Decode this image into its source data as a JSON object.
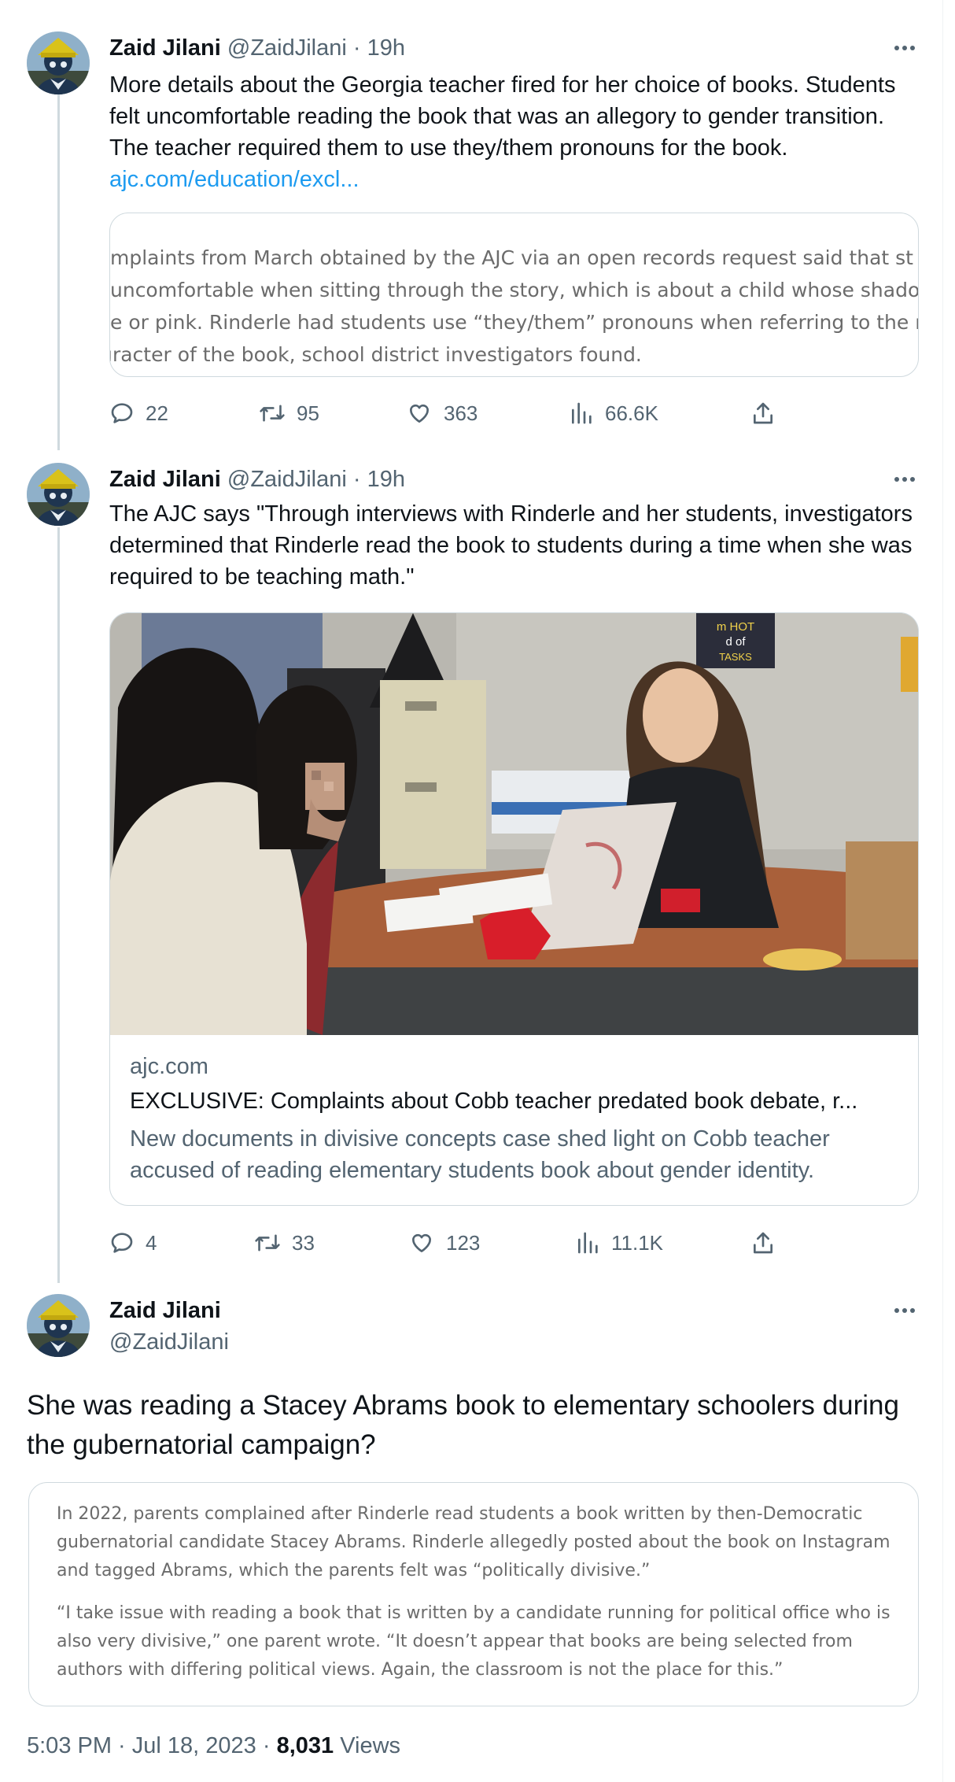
{
  "thread": [
    {
      "author": {
        "name": "Zaid Jilani",
        "handle": "@ZaidJilani",
        "time": "· 19h"
      },
      "text": "More details about the Georgia teacher fired for her choice of books. Students felt uncomfortable reading the book that was an allegory to gender transition. The teacher required them to use they/them pronouns for the book.",
      "link_text": "ajc.com/education/excl...",
      "quoted_excerpt": [
        "mplaints from March obtained by the AJC via an open records request said that st",
        " uncomfortable when sitting through the story, which is about a child whose shado",
        "e or pink. Rinderle had students use “they/them” pronouns when referring to the m",
        "ıracter of the book, school district investigators found."
      ],
      "stats": {
        "replies": "22",
        "retweets": "95",
        "likes": "363",
        "views": "66.6K"
      }
    },
    {
      "author": {
        "name": "Zaid Jilani",
        "handle": "@ZaidJilani",
        "time": "· 19h"
      },
      "text": "The AJC says \"Through interviews with Rinderle and her students, investigators determined that Rinderle read the book to students during a time when she was required to be teaching math.\"",
      "card": {
        "poster_text": [
          "m HOT",
          "d of",
          "TASKS"
        ],
        "domain": "ajc.com",
        "title": "EXCLUSIVE: Complaints about Cobb teacher predated book debate, r...",
        "description": "New documents in divisive concepts case shed light on Cobb teacher accused of reading elementary students book about gender identity."
      },
      "stats": {
        "replies": "4",
        "retweets": "33",
        "likes": "123",
        "views": "11.1K"
      }
    }
  ],
  "main_tweet": {
    "author": {
      "name": "Zaid Jilani",
      "handle": "@ZaidJilani"
    },
    "text": "She was reading a Stacey Abrams book to elementary schoolers during the gubernatorial campaign?",
    "quoted_paragraphs": [
      "In 2022, parents complained after Rinderle read students a book written by then-Democratic gubernatorial candidate Stacey Abrams. Rinderle allegedly posted about the book on Instagram and tagged Abrams, which the parents felt was “politically divisive.”",
      "“I take issue with reading a book that is written by a candidate running for political office who is also very divisive,” one parent wrote. “It doesn’t appear that books are being selected from authors with differing political views. Again, the classroom is not the place for this.”"
    ],
    "timestamp": "5:03 PM · Jul 18, 2023 · ",
    "views_count": "8,031",
    "views_label": "Views"
  },
  "colors": {
    "link": "#1d9bf0",
    "muted": "#536471",
    "text": "#0f1419",
    "border": "#cfd9de",
    "thread_line": "#cfd9de"
  },
  "icons": [
    "reply-icon",
    "retweet-icon",
    "like-icon",
    "views-icon",
    "share-icon",
    "more-icon"
  ]
}
